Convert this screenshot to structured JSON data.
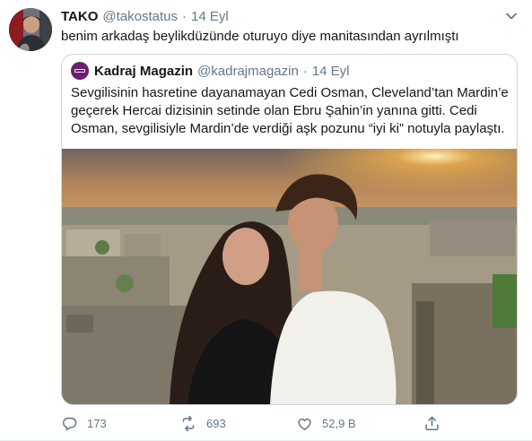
{
  "tweet": {
    "author_name": "TAKO",
    "author_handle": "@takostatus",
    "separator": "·",
    "date": "14 Eyl",
    "text": "benim arkadaş beylikdüzünde oturuyo diye manitasından ayrılmıştı",
    "avatar_icon": "profile-avatar",
    "more_icon": "chevron-down-icon"
  },
  "quote": {
    "author_name": "Kadraj Magazin",
    "author_handle": "@kadrajmagazin",
    "separator": "·",
    "date": "14 Eyl",
    "text_lines": [
      "Sevgilisinin hasretine dayanamayan Cedi Osman, Cleveland’tan Mardin’e",
      "geçerek Hercai dizisinin setinde olan Ebru Şahin’in yanına gitti. Cedi",
      "Osman, sevgilisiyle Mardin’de verdiği aşk pozunu “iyi ki” notuyla paylaştı."
    ],
    "image": "photo of a couple on a rooftop at sunset over Mardin",
    "brand_color": "#6b1f6e"
  },
  "actions": {
    "reply_count": "173",
    "retweet_count": "693",
    "like_count": "52,9 B",
    "icons": [
      "reply-icon",
      "retweet-icon",
      "like-icon",
      "share-icon"
    ]
  },
  "colors": {
    "text": "#14171a",
    "secondary": "#657786",
    "border": "#ccd6dd"
  }
}
